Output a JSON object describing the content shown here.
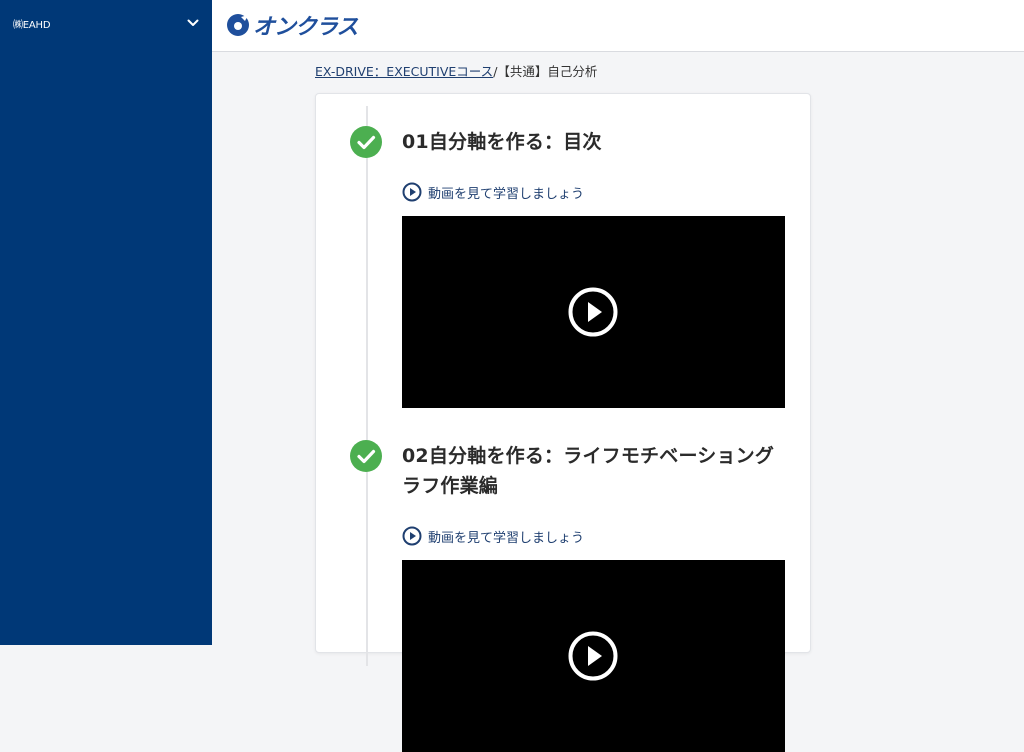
{
  "sidebar": {
    "org_name": "㈱EAHD",
    "toggle_icon": "chevron-down-icon"
  },
  "header": {
    "logo_text": "オンクラス",
    "logo_icon": "logo-mark-icon",
    "brand_color": "#1f4f9c"
  },
  "breadcrumb": {
    "course_link": "EX-DRIVE：EXECUTIVEコース",
    "separator": "/",
    "current": "【共通】自己分析"
  },
  "lessons": [
    {
      "title": "01自分軸を作る：目次",
      "watch_label": "動画を見て学習しましょう",
      "completed": true
    },
    {
      "title": "02自分軸を作る：ライフモチベーショングラフ作業編",
      "watch_label": "動画を見て学習しましょう",
      "completed": true
    }
  ],
  "colors": {
    "sidebar": "#003877",
    "check": "#4caf50",
    "link": "#1f3f70"
  }
}
